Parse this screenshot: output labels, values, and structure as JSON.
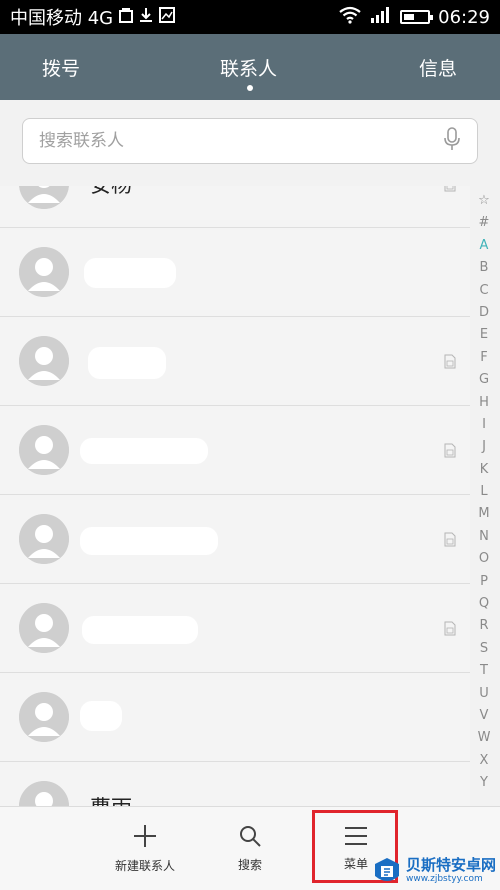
{
  "status_bar": {
    "carrier": "中国移动 4G",
    "time": "06:29"
  },
  "tabs": {
    "dial": "拨号",
    "contacts": "联系人",
    "messages": "信息"
  },
  "search": {
    "placeholder": "搜索联系人"
  },
  "contacts": [
    {
      "name": "安杨"
    },
    {
      "name": ""
    },
    {
      "name": ""
    },
    {
      "name": ""
    },
    {
      "name": ""
    },
    {
      "name": ""
    },
    {
      "name": ""
    },
    {
      "name": "曹雨"
    }
  ],
  "index_letters": [
    "☆",
    "#",
    "A",
    "B",
    "C",
    "D",
    "E",
    "F",
    "G",
    "H",
    "I",
    "J",
    "K",
    "L",
    "M",
    "N",
    "O",
    "P",
    "Q",
    "R",
    "S",
    "T",
    "U",
    "V",
    "W",
    "X",
    "Y"
  ],
  "index_active": "A",
  "bottom_bar": {
    "new_contact": "新建联系人",
    "search": "搜索",
    "menu": "菜单"
  },
  "watermark": {
    "title": "贝斯特安卓网",
    "url": "www.zjbstyy.com"
  },
  "colors": {
    "header": "#5b6e78",
    "accent": "#3fb3b8",
    "highlight": "#e0242c"
  }
}
